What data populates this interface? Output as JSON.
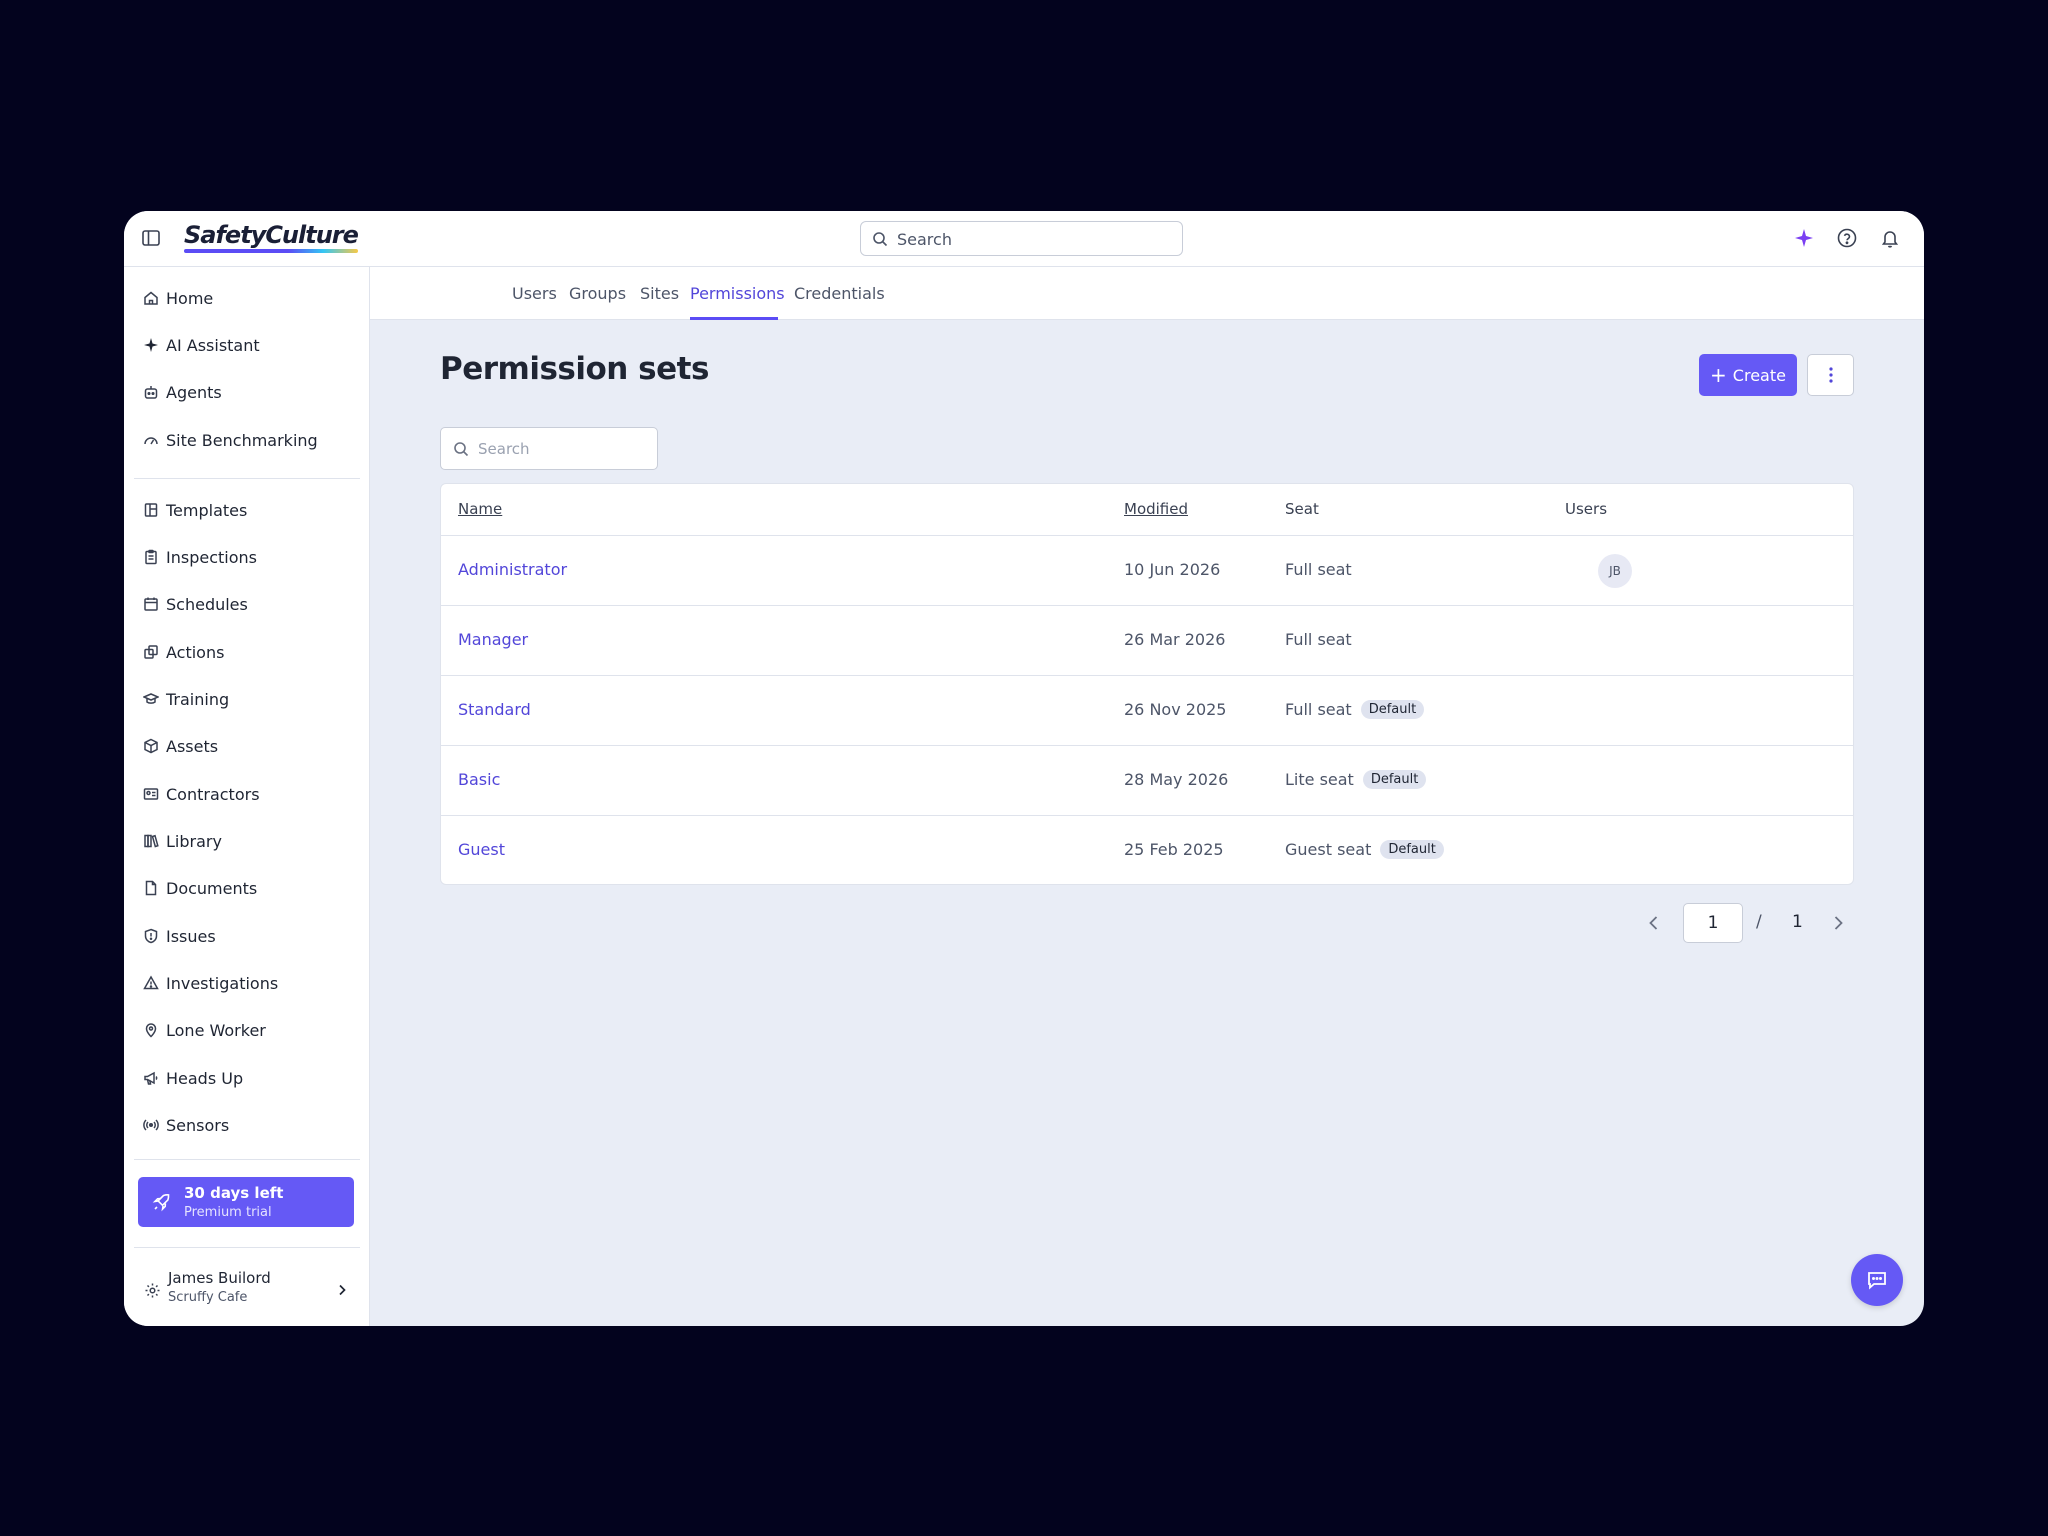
{
  "app": {
    "logo_text": "SafetyCulture",
    "search_placeholder": "Search"
  },
  "tabs": [
    {
      "label": "Users"
    },
    {
      "label": "Groups"
    },
    {
      "label": "Sites"
    },
    {
      "label": "Permissions",
      "active": true
    },
    {
      "label": "Credentials"
    }
  ],
  "sidebar": {
    "items": [
      {
        "label": "Home",
        "icon": "home-icon"
      },
      {
        "label": "AI Assistant",
        "icon": "sparkle-icon"
      },
      {
        "label": "Agents",
        "icon": "robot-icon"
      },
      {
        "label": "Site Benchmarking",
        "icon": "gauge-icon"
      },
      {
        "label": "Templates",
        "icon": "template-icon"
      },
      {
        "label": "Inspections",
        "icon": "clipboard-icon"
      },
      {
        "label": "Schedules",
        "icon": "calendar-icon"
      },
      {
        "label": "Actions",
        "icon": "actions-icon"
      },
      {
        "label": "Training",
        "icon": "graduation-cap-icon"
      },
      {
        "label": "Assets",
        "icon": "cube-icon"
      },
      {
        "label": "Contractors",
        "icon": "id-card-icon"
      },
      {
        "label": "Library",
        "icon": "books-icon"
      },
      {
        "label": "Documents",
        "icon": "document-icon"
      },
      {
        "label": "Issues",
        "icon": "issue-icon"
      },
      {
        "label": "Investigations",
        "icon": "warning-triangle-icon"
      },
      {
        "label": "Lone Worker",
        "icon": "map-pin-icon"
      },
      {
        "label": "Heads Up",
        "icon": "megaphone-icon"
      },
      {
        "label": "Sensors",
        "icon": "broadcast-icon"
      }
    ],
    "trial": {
      "title": "30 days left",
      "subtitle": "Premium trial"
    },
    "user": {
      "name": "James Builord",
      "org": "Scruffy Cafe"
    }
  },
  "main": {
    "title": "Permission sets",
    "create_label": "Create",
    "search_placeholder": "Search",
    "columns": [
      "Name",
      "Modified",
      "Seat",
      "Users"
    ],
    "rows": [
      {
        "name": "Administrator",
        "modified": "10 Jun 2026",
        "seat": "Full seat",
        "badge": "",
        "users": "JB"
      },
      {
        "name": "Manager",
        "modified": "26 Mar 2026",
        "seat": "Full seat",
        "badge": "",
        "users": ""
      },
      {
        "name": "Standard",
        "modified": "26 Nov 2025",
        "seat": "Full seat",
        "badge": "Default",
        "users": ""
      },
      {
        "name": "Basic",
        "modified": "28 May 2026",
        "seat": "Lite seat",
        "badge": "Default",
        "users": ""
      },
      {
        "name": "Guest",
        "modified": "25 Feb 2025",
        "seat": "Guest seat",
        "badge": "Default",
        "users": ""
      }
    ],
    "pagination": {
      "current": "1",
      "separator": "/",
      "total": "1"
    }
  },
  "colors": {
    "accent": "#6559f5",
    "link": "#5246d9",
    "background": "#e9edf6",
    "frame": "#03031e"
  }
}
